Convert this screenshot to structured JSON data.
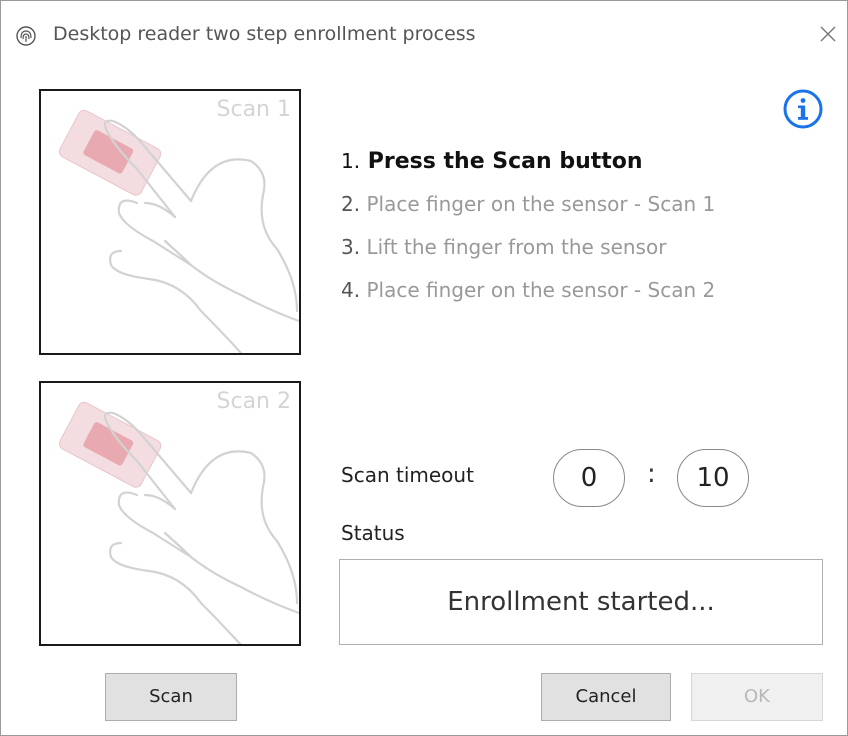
{
  "window": {
    "title": "Desktop reader two step enrollment process",
    "app_icon": "fingerprint-icon",
    "close_icon": "close-icon"
  },
  "scans": [
    {
      "label": "Scan 1"
    },
    {
      "label": "Scan 2"
    }
  ],
  "info_icon": "info-icon",
  "steps": [
    {
      "num": "1.",
      "text": "Press the Scan button",
      "active": true
    },
    {
      "num": "2.",
      "text": "Place finger on the sensor - Scan 1",
      "active": false
    },
    {
      "num": "3.",
      "text": "Lift the finger from the sensor",
      "active": false
    },
    {
      "num": "4.",
      "text": "Place finger on the sensor - Scan 2",
      "active": false
    }
  ],
  "timeout": {
    "label": "Scan timeout",
    "minutes": "0",
    "separator": ":",
    "seconds": "10"
  },
  "status": {
    "label": "Status",
    "value": "Enrollment started..."
  },
  "buttons": {
    "scan": "Scan",
    "cancel": "Cancel",
    "ok": "OK",
    "ok_enabled": false
  },
  "colors": {
    "accent": "#1a73e8",
    "sensor_red": "#e05060"
  }
}
